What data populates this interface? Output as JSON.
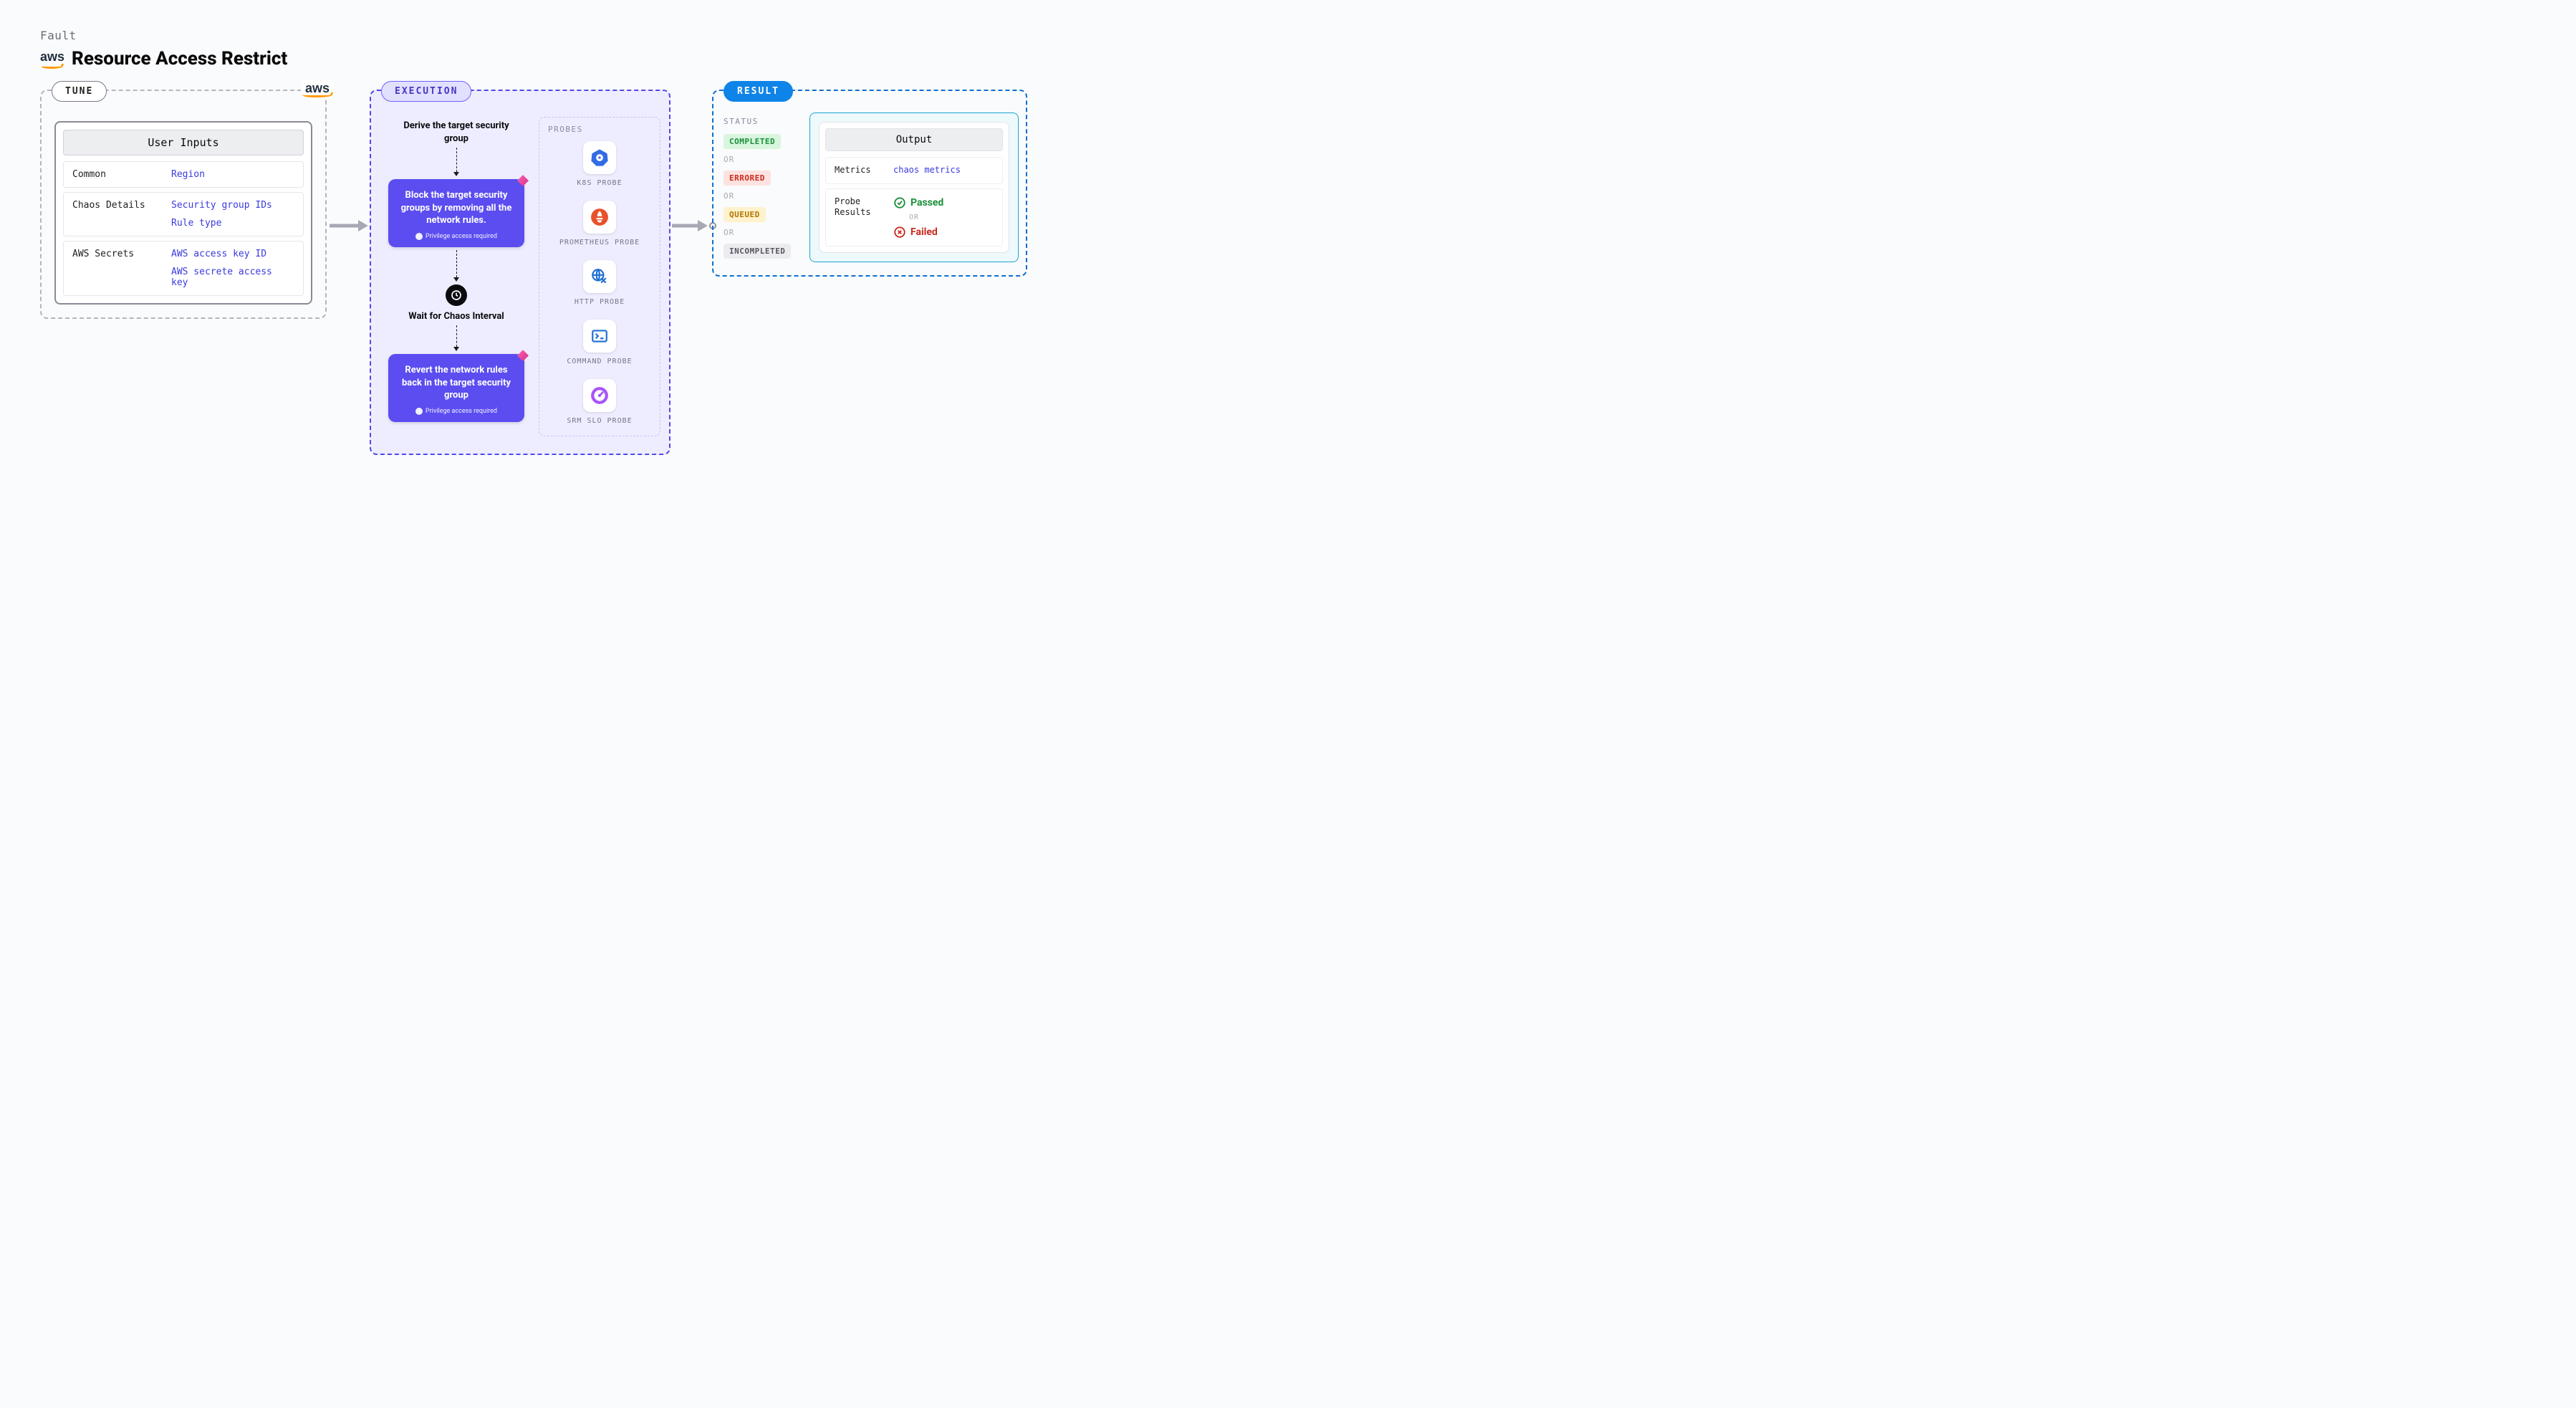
{
  "header": {
    "breadcrumb": "Fault",
    "provider": "aws",
    "title": "Resource Access Restrict"
  },
  "tune": {
    "label": "TUNE",
    "corner_provider": "aws",
    "inputs_header": "User Inputs",
    "rows": [
      {
        "key": "Common",
        "values": [
          "Region"
        ]
      },
      {
        "key": "Chaos Details",
        "values": [
          "Security group IDs",
          "Rule type"
        ]
      },
      {
        "key": "AWS Secrets",
        "values": [
          "AWS access key ID",
          "AWS secrete access key"
        ]
      }
    ]
  },
  "execution": {
    "label": "EXECUTION",
    "step_derive": "Derive the target security group",
    "step_block": "Block the target security groups by removing all the network rules.",
    "step_wait": "Wait for Chaos Interval",
    "step_revert": "Revert the network rules back in the target security group",
    "privilege_note": "Privilege access required",
    "probes_label": "PROBES",
    "probes": {
      "k8s": "K8S PROBE",
      "prom": "PROMETHEUS PROBE",
      "http": "HTTP PROBE",
      "cmd": "COMMAND PROBE",
      "srm": "SRM SLO PROBE"
    }
  },
  "result": {
    "label": "RESULT",
    "status_label": "STATUS",
    "or_label": "OR",
    "statuses": {
      "completed": "COMPLETED",
      "errored": "ERRORED",
      "queued": "QUEUED",
      "incompleted": "INCOMPLETED"
    },
    "output_header": "Output",
    "metrics_key": "Metrics",
    "metrics_link": "chaos metrics",
    "probe_results_key": "Probe Results",
    "passed": "Passed",
    "failed": "Failed"
  }
}
